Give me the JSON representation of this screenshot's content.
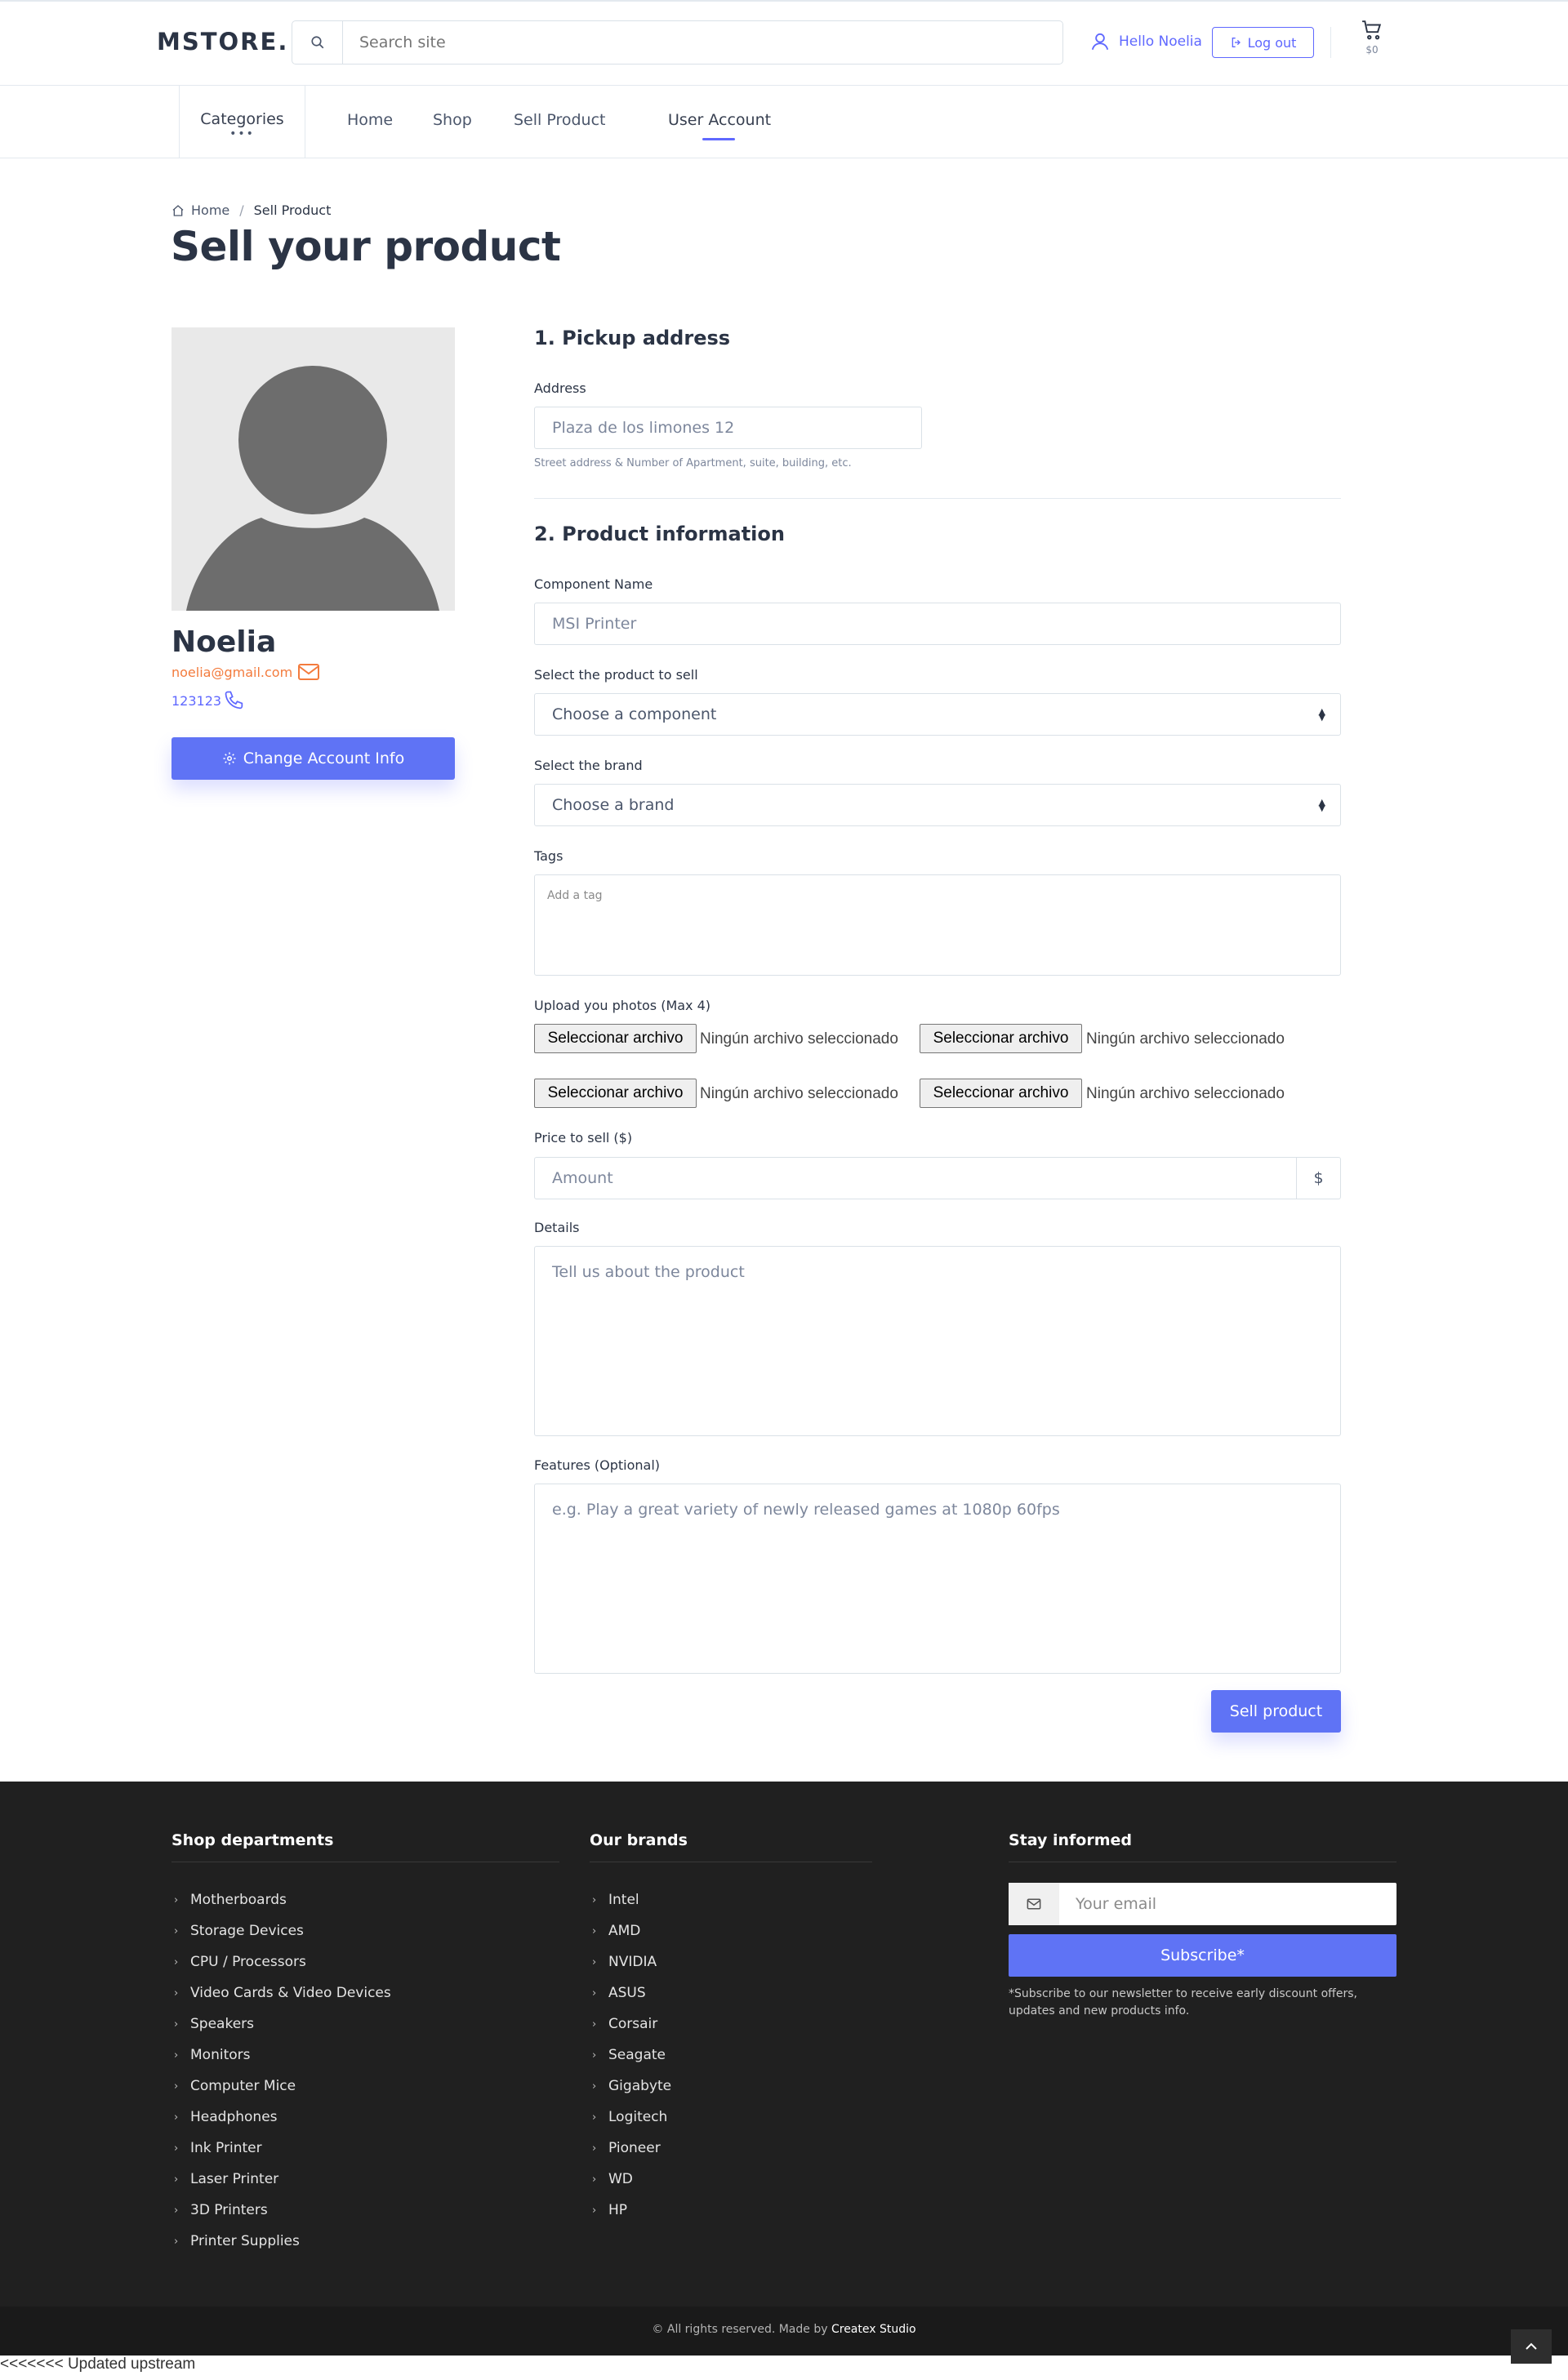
{
  "header": {
    "logo": "MSTORE.",
    "search_placeholder": "Search site",
    "greeting": "Hello Noelia",
    "logout_label": "Log out",
    "cart_amount": "$0"
  },
  "nav": {
    "categories_label": "Categories",
    "categories_dots": "•••",
    "links": [
      "Home",
      "Shop",
      "Sell Product",
      "User Account"
    ],
    "active": "User Account"
  },
  "breadcrumb": {
    "home": "Home",
    "separator": "/",
    "current": "Sell Product"
  },
  "page_title": "Sell your product",
  "profile": {
    "name": "Noelia",
    "email": "noelia@gmail.com",
    "phone": "123123",
    "change_button": "Change Account Info"
  },
  "form": {
    "section1_title": "1. Pickup address",
    "address_label": "Address",
    "address_placeholder": "Plaza de los limones 12",
    "address_hint": "Street address & Number of Apartment, suite, building, etc.",
    "section2_title": "2. Product information",
    "component_label": "Component Name",
    "component_placeholder": "MSI Printer",
    "product_label": "Select the product to sell",
    "product_selected": "Choose a component",
    "brand_label": "Select the brand",
    "brand_selected": "Choose a brand",
    "tags_label": "Tags",
    "tags_placeholder": "Add a tag",
    "photos_label": "Upload you photos (Max 4)",
    "file_button": "Seleccionar archivo",
    "file_status": "Ningún archivo seleccionado",
    "price_label": "Price to sell ($)",
    "price_placeholder": "Amount",
    "price_addon": "$",
    "details_label": "Details",
    "details_placeholder": "Tell us about the product",
    "features_label": "Features (Optional)",
    "features_placeholder": "e.g. Play a great variety of newly released games at 1080p 60fps",
    "submit_label": "Sell product"
  },
  "footer": {
    "departments_title": "Shop departments",
    "departments": [
      "Motherboards",
      "Storage Devices",
      "CPU / Processors",
      "Video Cards & Video Devices",
      "Speakers",
      "Monitors",
      "Computer Mice",
      "Headphones",
      "Ink Printer",
      "Laser Printer",
      "3D Printers",
      "Printer Supplies"
    ],
    "brands_title": "Our brands",
    "brands": [
      "Intel",
      "AMD",
      "NVIDIA",
      "ASUS",
      "Corsair",
      "Seagate",
      "Gigabyte",
      "Logitech",
      "Pioneer",
      "WD",
      "HP"
    ],
    "newsletter_title": "Stay informed",
    "email_placeholder": "Your email",
    "subscribe_label": "Subscribe*",
    "subscribe_note": "*Subscribe to our newsletter to receive early discount offers, updates and new products info.",
    "copyright": "© All rights reserved. Made by",
    "studio": "Createx Studio"
  },
  "debug_text": "<<<<<<< Updated upstream",
  "colors": {
    "accent": "#5f73f5",
    "email": "#f37b3d",
    "footer_bg": "#202020"
  }
}
